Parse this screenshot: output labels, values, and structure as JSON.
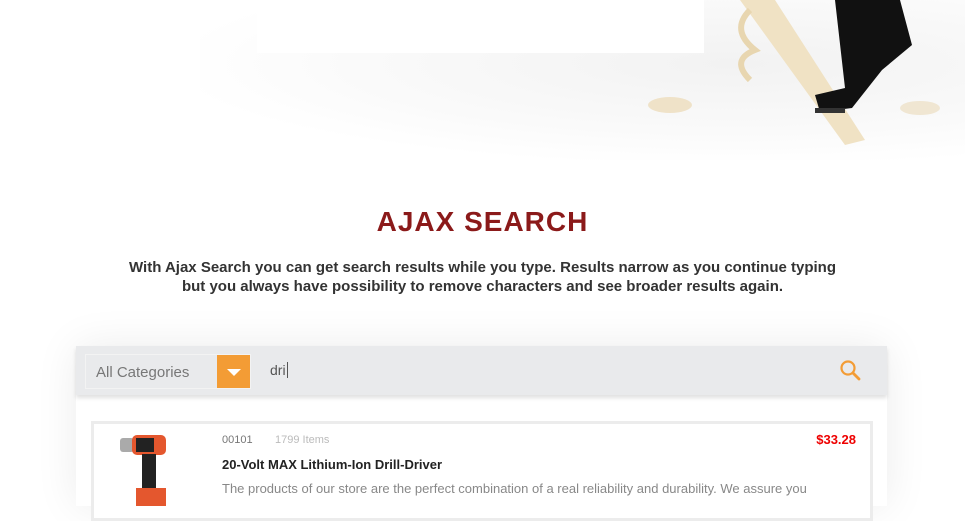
{
  "section": {
    "title": "AJAX SEARCH",
    "description": "With Ajax Search you can get search results while you type. Results narrow as you continue typing but you always have possibility to remove characters and see broader results again."
  },
  "search": {
    "category": "All Categories",
    "query": "dri",
    "icon": "search-icon",
    "accent": "#f39c35"
  },
  "results": [
    {
      "sku": "00101",
      "count": "1799 Items",
      "price": "$33.28",
      "name": "20-Volt MAX Lithium-Ion Drill-Driver",
      "description": "The products of our store are the perfect combination of a real reliability and durability. We assure you"
    }
  ],
  "colors": {
    "title": "#8b1a1a",
    "price": "#ee0000"
  }
}
